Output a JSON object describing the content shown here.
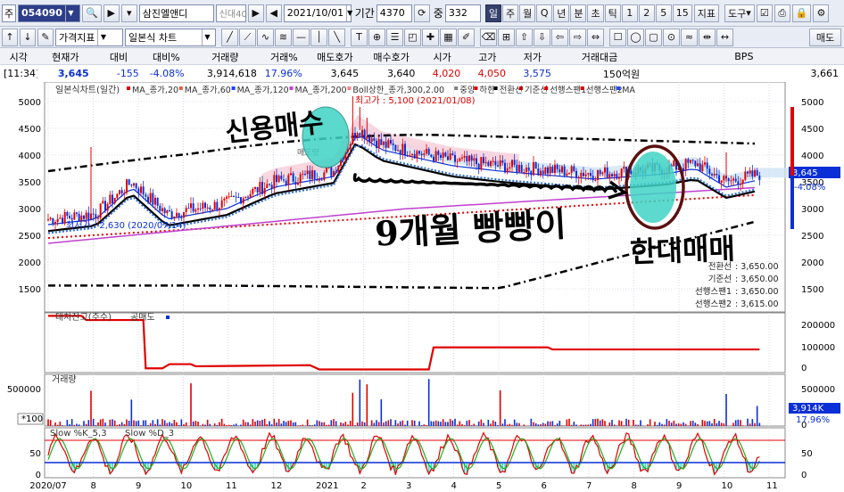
{
  "toolbar": {
    "market_label": "주",
    "code": "054090",
    "stock_name": "삼진엘앤디",
    "badge": "신대40",
    "date": "2021/10/01",
    "period_label": "기간",
    "period_value": "4370",
    "mid_label": "중",
    "mid_value": "332",
    "intervals": [
      "일",
      "주",
      "월",
      "Q",
      "년",
      "분",
      "초",
      "틱",
      "1",
      "2",
      "5",
      "15"
    ],
    "indicator_btn": "지표",
    "tool_btn": "도구",
    "price_indicator": "가격지표",
    "chart_type": "일본식 차트",
    "sell_label": "매도"
  },
  "quote": {
    "headers": [
      "시각",
      "현재가",
      "대비",
      "대비%",
      "거래량",
      "거래%",
      "매도호가",
      "매수호가",
      "시가",
      "고가",
      "저가",
      "거래대금",
      "BPS"
    ],
    "values": [
      "[11:34]",
      "3,645",
      "-155",
      "-4.08%",
      "3,914,618",
      "17.96%",
      "3,645",
      "3,640",
      "4,020",
      "4,050",
      "3,575",
      "150억원",
      "3,661"
    ]
  },
  "chart": {
    "main_legend_title": "일본식차트(일간)",
    "legend_items": [
      "MA_종가,20",
      "MA_종가,60",
      "MA_종가,120",
      "MA_종가,200",
      "Boll상한_종가,300,2.00",
      "중앙",
      "하한",
      "전환선",
      "기준선",
      "선행스팬1",
      "선행스팬2",
      "MA"
    ],
    "max_label": "최고가 : 5,100 (2021/01/08)",
    "min_label": "최저가 : 2,630 (2020/07/14)",
    "price_axis": [
      "5000",
      "4500",
      "4000",
      "3500",
      "3000",
      "2500",
      "2000",
      "1500"
    ],
    "current_price": "3,645",
    "current_pct": "-4.08%",
    "ichimoku": [
      {
        "label": "전환선",
        "value": ": 3,650.00"
      },
      {
        "label": "기준선",
        "value": ": 3,650.00"
      },
      {
        "label": "선행스팬1",
        "value": ": 3,650.00"
      },
      {
        "label": "선행스팬2",
        "value": ": 3,615.00"
      }
    ],
    "credit_legend": "대차잔고(주수)",
    "short_legend": "공매도",
    "credit_axis": [
      "200000",
      "100000",
      "0"
    ],
    "volume_legend": "거래량",
    "volume_axis_left": "500000",
    "volume_axis_right": [
      "500000",
      "0"
    ],
    "volume_unit": "*100",
    "volume_current": "3,914K",
    "volume_pct": "17.96%",
    "stoch_legend": [
      "Slow %K_5,3",
      "Slow %D_3"
    ],
    "stoch_axis": [
      "50",
      "0"
    ],
    "x_labels": [
      "2020/07",
      "8",
      "9",
      "10",
      "11",
      "12",
      "2021",
      "2",
      "3",
      "4",
      "5",
      "6",
      "7",
      "8",
      "9",
      "10",
      "11"
    ],
    "inner_label": "매도량"
  },
  "annotations": {
    "credit_buy": "신용매수",
    "nine_months": "9개월 빵빵이",
    "sell_off": "한대매매"
  },
  "colors": {
    "up": "#e00000",
    "down": "#0a2fd6",
    "accent": "#35406b",
    "highlight": "#3fd3c5"
  }
}
